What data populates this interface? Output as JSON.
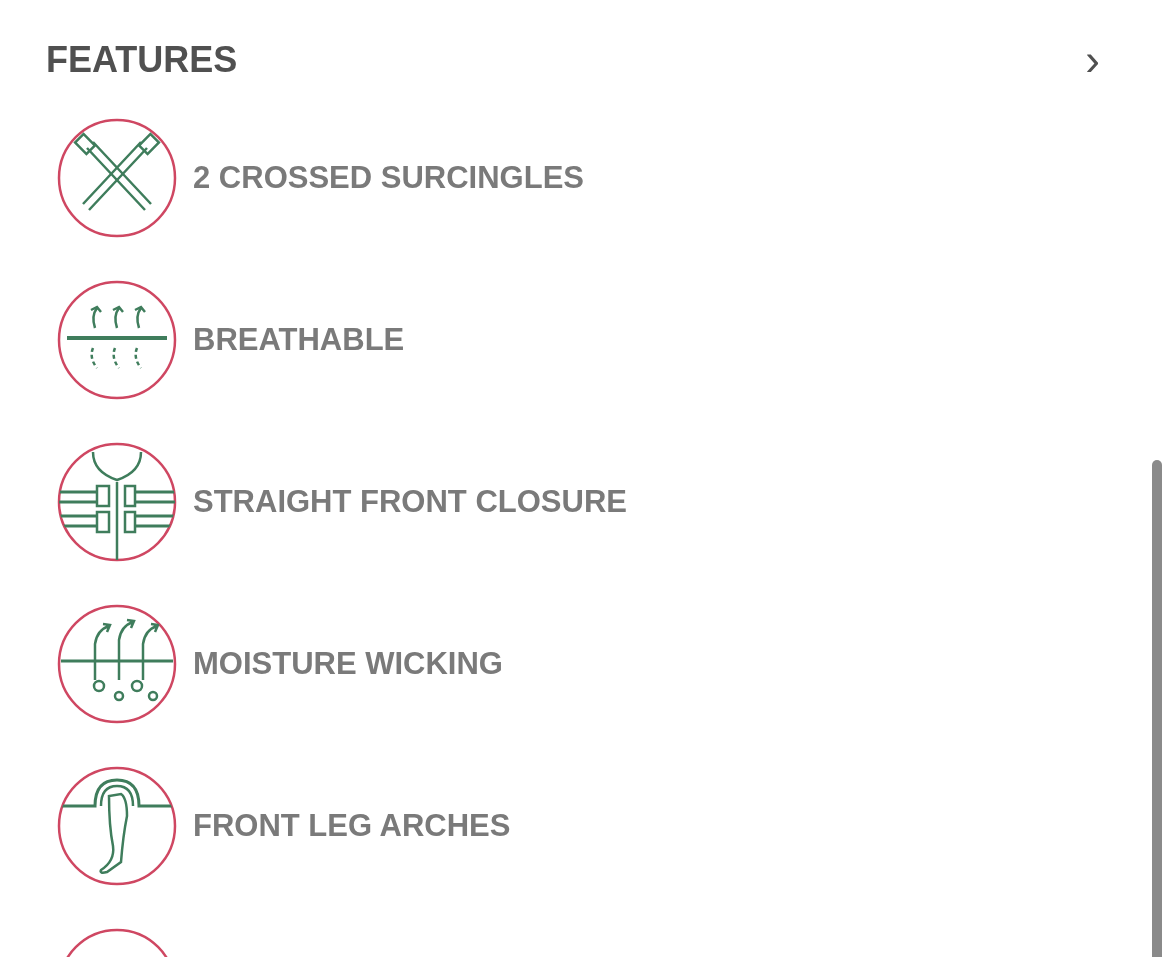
{
  "section": {
    "title": "FEATURES",
    "expand_icon": "›"
  },
  "features": [
    {
      "kind": "crossed",
      "label": "2 CROSSED SURCINGLES"
    },
    {
      "kind": "breathable",
      "label": "BREATHABLE"
    },
    {
      "kind": "closure",
      "label": "STRAIGHT FRONT CLOSURE"
    },
    {
      "kind": "wicking",
      "label": "MOISTURE WICKING"
    },
    {
      "kind": "leg",
      "label": "FRONT LEG ARCHES"
    },
    {
      "kind": "cut_off"
    }
  ]
}
